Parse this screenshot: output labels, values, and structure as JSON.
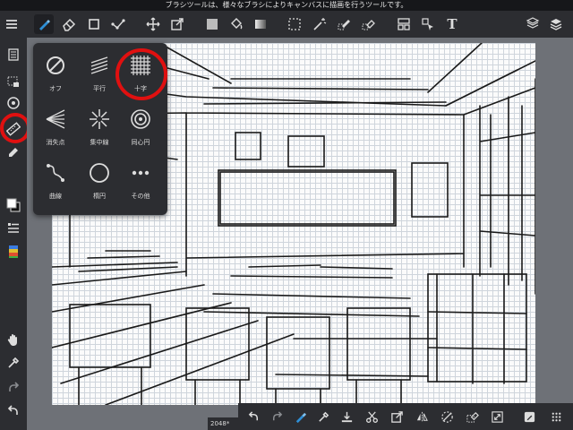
{
  "tip_text": "ブラシツールは、様々なブラシによりキャンバスに描画を行うツールです。",
  "ruler_popup": {
    "items": [
      {
        "label": "オフ",
        "icon": "no-ruler-icon"
      },
      {
        "label": "平行",
        "icon": "parallel-lines-icon"
      },
      {
        "label": "十字",
        "icon": "cross-grid-icon"
      },
      {
        "label": "消失点",
        "icon": "vanishing-point-icon"
      },
      {
        "label": "集中線",
        "icon": "radial-lines-icon"
      },
      {
        "label": "同心円",
        "icon": "concentric-circles-icon"
      },
      {
        "label": "曲線",
        "icon": "curve-icon"
      },
      {
        "label": "楕円",
        "icon": "ellipse-icon"
      },
      {
        "label": "その他",
        "icon": "more-dots-icon"
      }
    ]
  },
  "canvas": {
    "size_label": "2048*"
  },
  "toolbar": {
    "text_tool_glyph": "T"
  },
  "colors": {
    "accent": "#2e8fd6",
    "highlight": "#e01010",
    "ui_bg": "#2c2d31"
  }
}
